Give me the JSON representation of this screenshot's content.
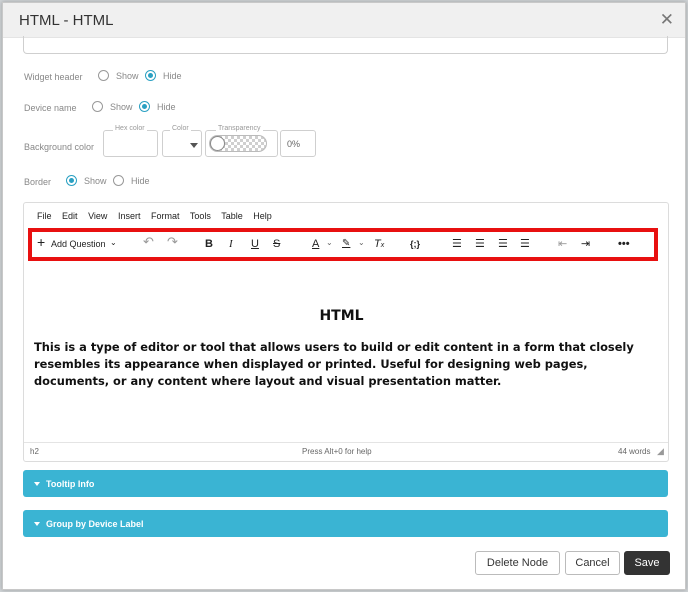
{
  "dialog": {
    "title": "HTML - HTML",
    "close_glyph": "✕"
  },
  "widget_header": {
    "label": "Widget header",
    "show": "Show",
    "hide": "Hide",
    "selected": "Hide"
  },
  "device_name": {
    "label": "Device name",
    "show": "Show",
    "hide": "Hide",
    "selected": "Hide"
  },
  "background_color": {
    "label": "Background color",
    "hex_legend": "Hex color",
    "hex_value": "",
    "color_legend": "Color",
    "transparency_legend": "Transparency",
    "transparency_value": "0%"
  },
  "border": {
    "label": "Border",
    "show": "Show",
    "hide": "Hide",
    "selected": "Show"
  },
  "editor": {
    "menu": [
      "File",
      "Edit",
      "View",
      "Insert",
      "Format",
      "Tools",
      "Table",
      "Help"
    ],
    "toolbar": {
      "add_question": "Add Question",
      "icons": [
        "plus-icon",
        "chevron-down-icon",
        "undo-icon",
        "redo-icon",
        "bold-icon",
        "italic-icon",
        "underline-icon",
        "strikethrough-icon",
        "text-color-icon",
        "highlight-color-icon",
        "clear-formatting-icon",
        "insert-variable-icon",
        "align-left-icon",
        "align-center-icon",
        "align-right-icon",
        "justify-icon",
        "outdent-icon",
        "indent-icon",
        "more-icon"
      ]
    },
    "content": {
      "heading": "HTML",
      "paragraph": "This is a type of editor or tool that allows users to build or edit content in a form that closely resembles its appearance when displayed or printed. Useful for designing web pages, documents, or any content where layout and visual presentation matter."
    },
    "status": {
      "element_path": "h2",
      "help_hint": "Press Alt+0 for help",
      "word_count": "44 words"
    }
  },
  "sections": {
    "tooltip_info": "Tooltip Info",
    "group_by_device_label": "Group by Device Label"
  },
  "buttons": {
    "delete_node": "Delete Node",
    "cancel": "Cancel",
    "save": "Save"
  },
  "colors": {
    "accent": "#3ab4d3",
    "highlight_border": "#e81010",
    "save_button": "#333333"
  }
}
